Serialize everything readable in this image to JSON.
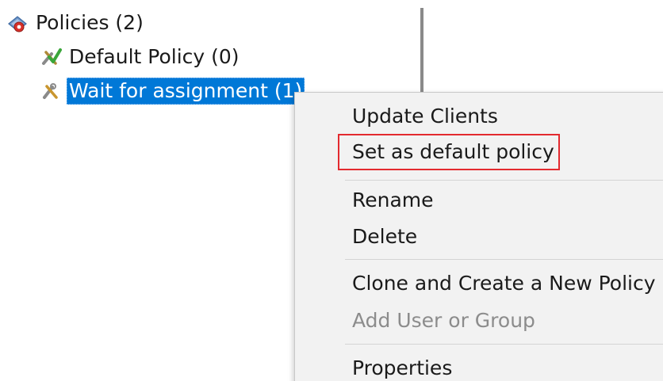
{
  "tree": {
    "root": {
      "label": "Policies (2)",
      "icon": "policies-folder-icon"
    },
    "children": [
      {
        "label": "Default Policy (0)",
        "icon": "default-policy-icon",
        "selected": false
      },
      {
        "label": "Wait for assignment (1)",
        "icon": "policy-tools-icon",
        "selected": true
      }
    ]
  },
  "context_menu": {
    "items": [
      {
        "label": "Update Clients",
        "enabled": true
      },
      {
        "label": "Set as default policy",
        "enabled": true,
        "highlighted": true
      },
      {
        "label": "Rename",
        "enabled": true
      },
      {
        "label": "Delete",
        "enabled": true
      },
      {
        "label": "Clone and Create a New Policy",
        "enabled": true
      },
      {
        "label": "Add User or Group",
        "enabled": false
      },
      {
        "label": "Properties",
        "enabled": true
      }
    ],
    "highlight_color": "#e32a2f"
  },
  "colors": {
    "selection": "#0078d7",
    "menu_background": "#f2f2f2"
  }
}
